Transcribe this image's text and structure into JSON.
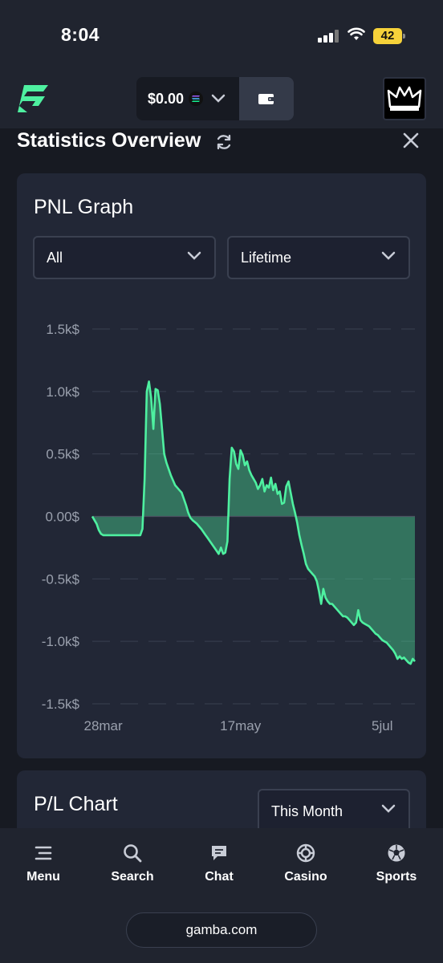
{
  "status_bar": {
    "time": "8:04",
    "battery": "42",
    "signal_icon": "cellular-signal-icon",
    "wifi_icon": "wifi-icon"
  },
  "header": {
    "logo_icon": "gamba-logo-icon",
    "balance": "$0.00",
    "currency_icon": "solana-icon",
    "wallet_icon": "wallet-icon",
    "avatar_icon": "crown-avatar-icon"
  },
  "overview": {
    "title": "Statistics Overview"
  },
  "pnl": {
    "title": "PNL Graph",
    "filter_type": "All",
    "filter_period": "Lifetime"
  },
  "pl_chart": {
    "title": "P/L Chart",
    "period": "This Month"
  },
  "nav": [
    {
      "label": "Menu",
      "icon": "menu-icon"
    },
    {
      "label": "Search",
      "icon": "search-icon"
    },
    {
      "label": "Chat",
      "icon": "chat-icon"
    },
    {
      "label": "Casino",
      "icon": "casino-chip-icon"
    },
    {
      "label": "Sports",
      "icon": "soccer-ball-icon"
    }
  ],
  "browser": {
    "url": "gamba.com"
  },
  "colors": {
    "accent": "#4ef0a0",
    "card": "#222736",
    "background": "#171a22"
  },
  "chart_data": {
    "type": "area",
    "title": "PNL Graph",
    "ylim": [
      -1500,
      1500
    ],
    "y_ticks": [
      1500,
      1000,
      500,
      0,
      -500,
      -1000,
      -1500
    ],
    "y_tick_labels": [
      "1.5k$",
      "1.0k$",
      "0.5k$",
      "0.00$",
      "-0.5k$",
      "-1.0k$",
      "-1.5k$"
    ],
    "x_tick_labels": [
      "28mar",
      "17may",
      "5jul"
    ],
    "x_tick_index": [
      5,
      68,
      133
    ],
    "grid": true,
    "series": [
      {
        "values": [
          0,
          -30,
          -60,
          -110,
          -140,
          -150,
          -150,
          -150,
          -150,
          -150,
          -150,
          -150,
          -150,
          -150,
          -150,
          -150,
          -150,
          -150,
          -150,
          -150,
          -150,
          -150,
          -150,
          -100,
          300,
          1000,
          1080,
          950,
          700,
          1020,
          1010,
          900,
          700,
          500,
          430,
          380,
          330,
          290,
          250,
          230,
          210,
          190,
          140,
          90,
          30,
          -10,
          -30,
          -45,
          -60,
          -80,
          -100,
          -125,
          -150,
          -175,
          -200,
          -225,
          -250,
          -275,
          -300,
          -250,
          -300,
          -290,
          -200,
          300,
          550,
          520,
          420,
          380,
          530,
          490,
          410,
          440,
          370,
          330,
          300,
          270,
          220,
          250,
          300,
          200,
          250,
          230,
          310,
          210,
          260,
          180,
          200,
          100,
          110,
          240,
          280,
          190,
          100,
          30,
          -50,
          -150,
          -230,
          -300,
          -380,
          -420,
          -440,
          -460,
          -480,
          -520,
          -600,
          -700,
          -580,
          -650,
          -680,
          -700,
          -700,
          -720,
          -740,
          -760,
          -780,
          -800,
          -800,
          -810,
          -830,
          -850,
          -870,
          -850,
          -750,
          -830,
          -850,
          -860,
          -870,
          -880,
          -900,
          -920,
          -940,
          -950,
          -970,
          -990,
          -1000,
          -1010,
          -1030,
          -1050,
          -1070,
          -1100,
          -1140,
          -1120,
          -1140,
          -1130,
          -1150,
          -1170,
          -1180,
          -1140,
          -1160
        ]
      }
    ]
  }
}
